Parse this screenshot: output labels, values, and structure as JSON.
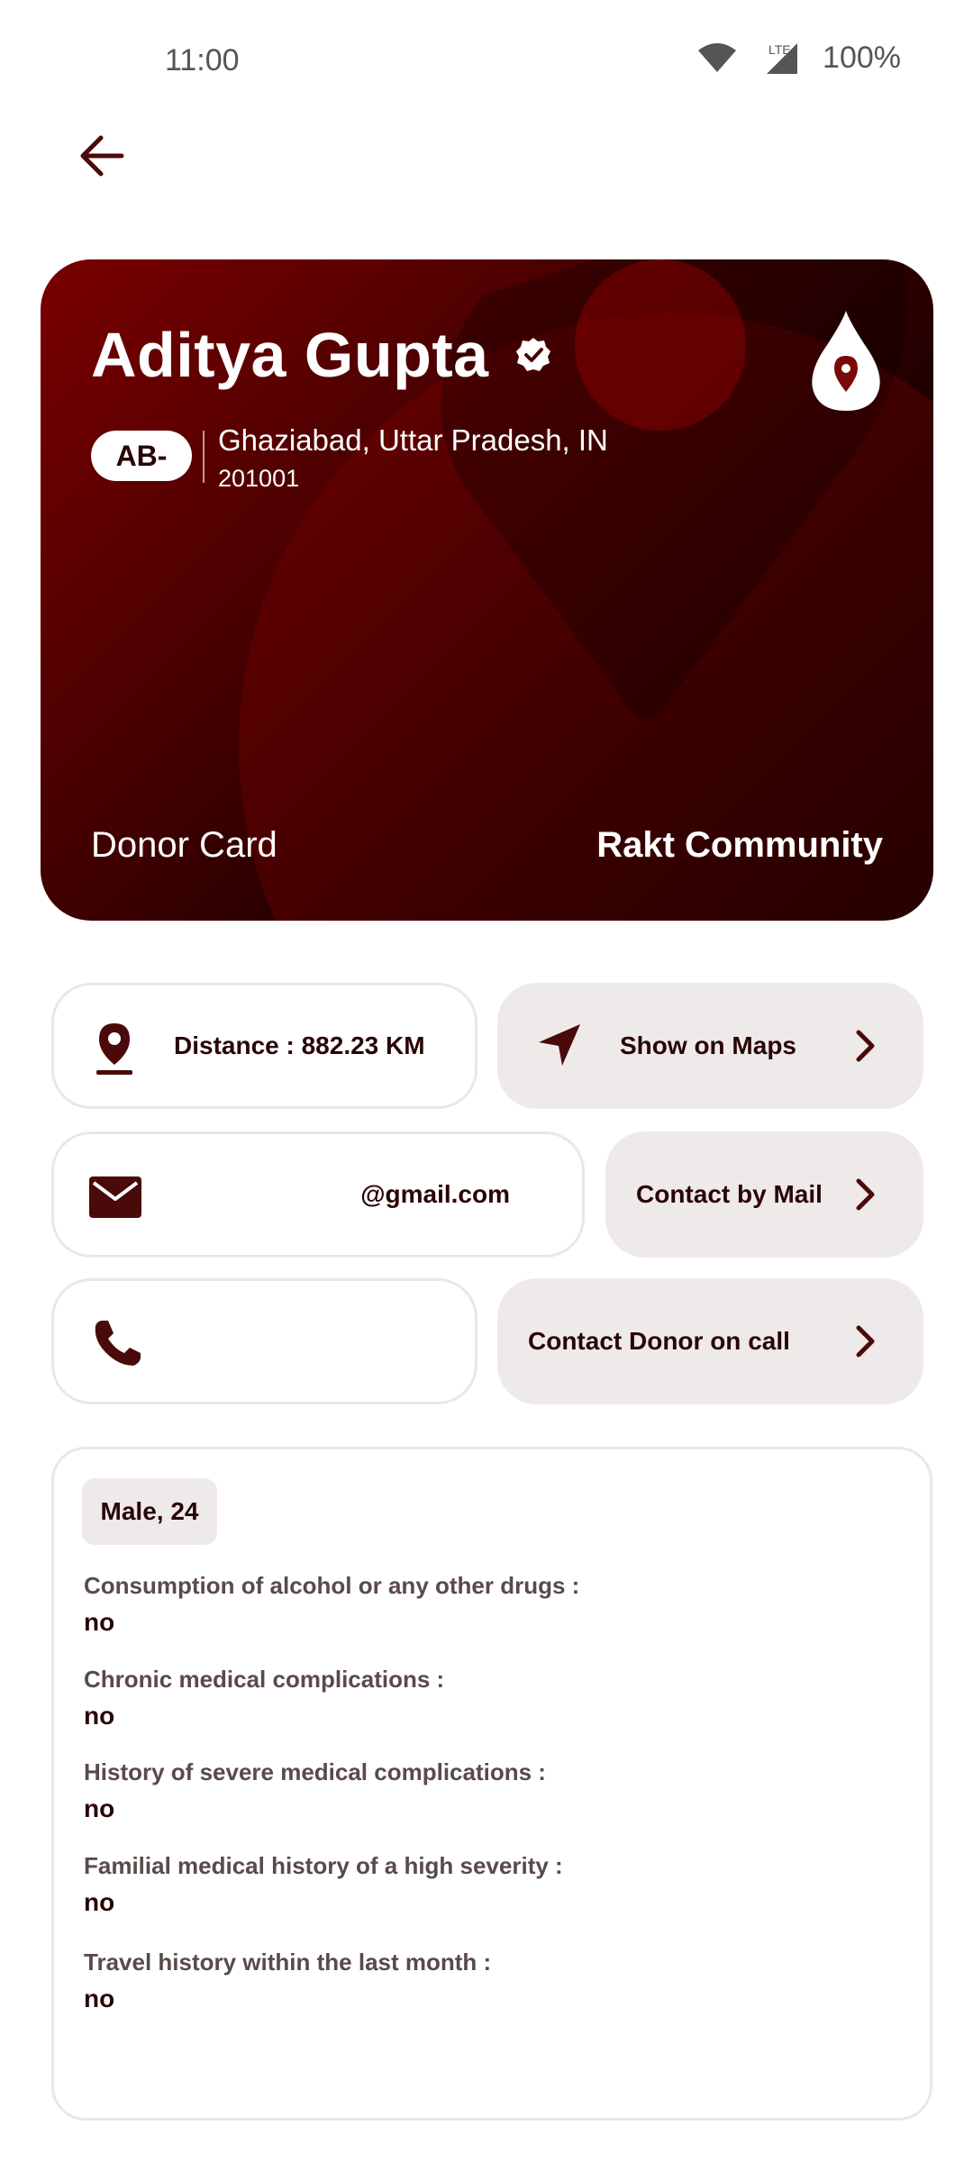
{
  "status_bar": {
    "time": "11:00",
    "network": "LTE",
    "battery": "100%"
  },
  "donor": {
    "name": "Aditya Gupta",
    "blood_group": "AB-",
    "location": "Ghaziabad, Uttar Pradesh, IN",
    "pincode": "201001",
    "card_label": "Donor Card",
    "brand": "Rakt Community"
  },
  "actions": {
    "distance_text": "Distance : 882.23 KM",
    "maps_label": "Show on Maps",
    "email_text": "@gmail.com",
    "mail_label": "Contact by Mail",
    "call_label": "Contact Donor on call"
  },
  "details": {
    "tag": "Male, 24",
    "items": [
      {
        "question": "Consumption of alcohol or any other drugs :",
        "answer": "no"
      },
      {
        "question": "Chronic medical complications :",
        "answer": "no"
      },
      {
        "question": "History of severe medical complications :",
        "answer": "no"
      },
      {
        "question": "Familial medical history of a high severity :",
        "answer": "no"
      },
      {
        "question": "Travel history within the last month :",
        "answer": "no"
      }
    ]
  },
  "colors": {
    "primary": "#4a0a0a",
    "card_light": "#7a0000",
    "card_dark": "#000000",
    "pill_fill": "#efeaea"
  }
}
